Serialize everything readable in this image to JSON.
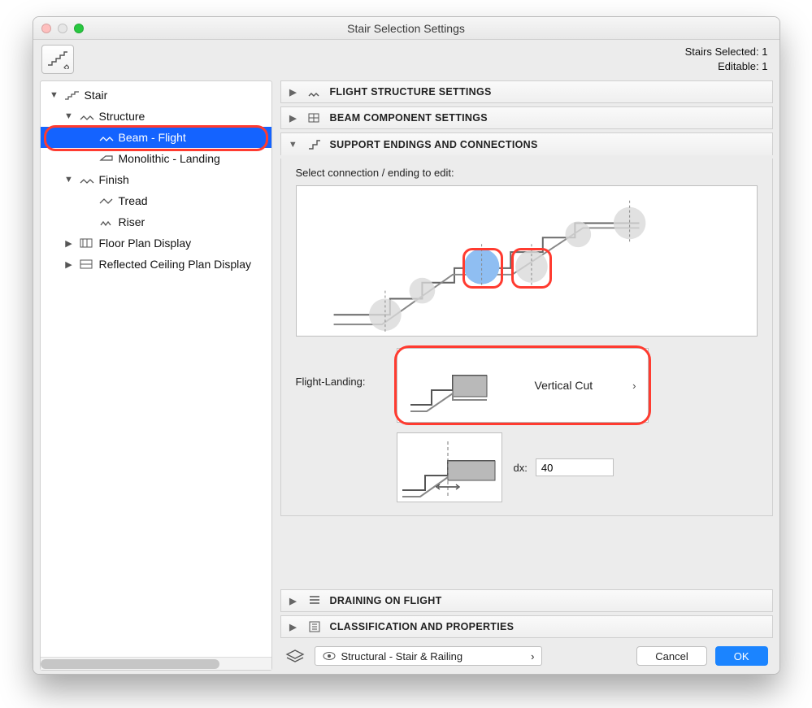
{
  "window": {
    "title": "Stair Selection Settings"
  },
  "status": {
    "selected_label": "Stairs Selected: 1",
    "editable_label": "Editable: 1"
  },
  "tree": {
    "items": [
      {
        "label": "Stair"
      },
      {
        "label": "Structure"
      },
      {
        "label": "Beam - Flight"
      },
      {
        "label": "Monolithic - Landing"
      },
      {
        "label": "Finish"
      },
      {
        "label": "Tread"
      },
      {
        "label": "Riser"
      },
      {
        "label": "Floor Plan Display"
      },
      {
        "label": "Reflected Ceiling Plan Display"
      }
    ]
  },
  "accordion": {
    "flight_structure": "FLIGHT STRUCTURE SETTINGS",
    "beam_component": "BEAM COMPONENT SETTINGS",
    "support": "SUPPORT ENDINGS AND CONNECTIONS",
    "draining": "DRAINING ON FLIGHT",
    "classification": "CLASSIFICATION AND PROPERTIES"
  },
  "support_section": {
    "prompt": "Select connection / ending to edit:",
    "flight_landing_label": "Flight-Landing:",
    "flight_landing_value": "Vertical Cut",
    "dx_label": "dx:",
    "dx_value": "40"
  },
  "footer": {
    "layer_value": "Structural - Stair & Railing",
    "cancel": "Cancel",
    "ok": "OK"
  }
}
